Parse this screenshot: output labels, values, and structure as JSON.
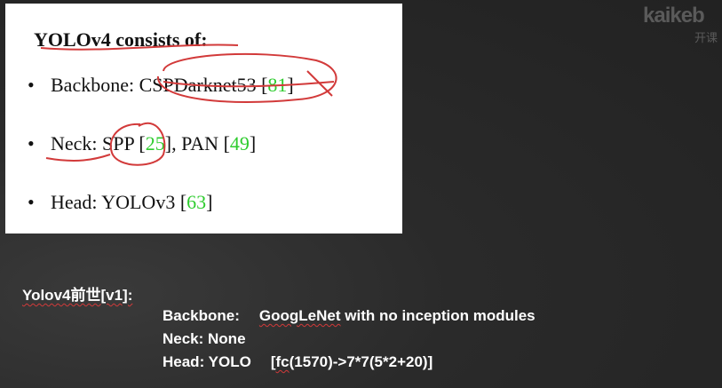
{
  "slide": {
    "title": "YOLOv4 consists of:",
    "bullets": [
      {
        "label": "Backbone:",
        "name": "CSPDarknet53",
        "open": "[",
        "ref": "81",
        "close": "]"
      },
      {
        "label": "Neck:",
        "name": "SPP",
        "open": "[",
        "ref": "25",
        "sep": "], PAN [",
        "ref2": "49",
        "close": "]"
      },
      {
        "label": "Head:",
        "name": "YOLOv3",
        "open": "[",
        "ref": "63",
        "close": "]"
      }
    ],
    "bullet_char": "•"
  },
  "logo": {
    "word": "kaikeb",
    "sub": "开课"
  },
  "notes": {
    "heading": "Yolov4前世[v1]:",
    "backbone_label": "Backbone:",
    "backbone_value_a": "GoogLeNet",
    "backbone_value_b": " with no inception modules",
    "neck": "Neck: None",
    "head_label": "Head: YOLO",
    "head_value_a": "[",
    "head_value_b": "fc",
    "head_value_c": "(1570)->7*7(5*2+20)]"
  },
  "colors": {
    "reference": "#2ecc2e",
    "annotation": "#d23a3a",
    "background": "#252525"
  }
}
